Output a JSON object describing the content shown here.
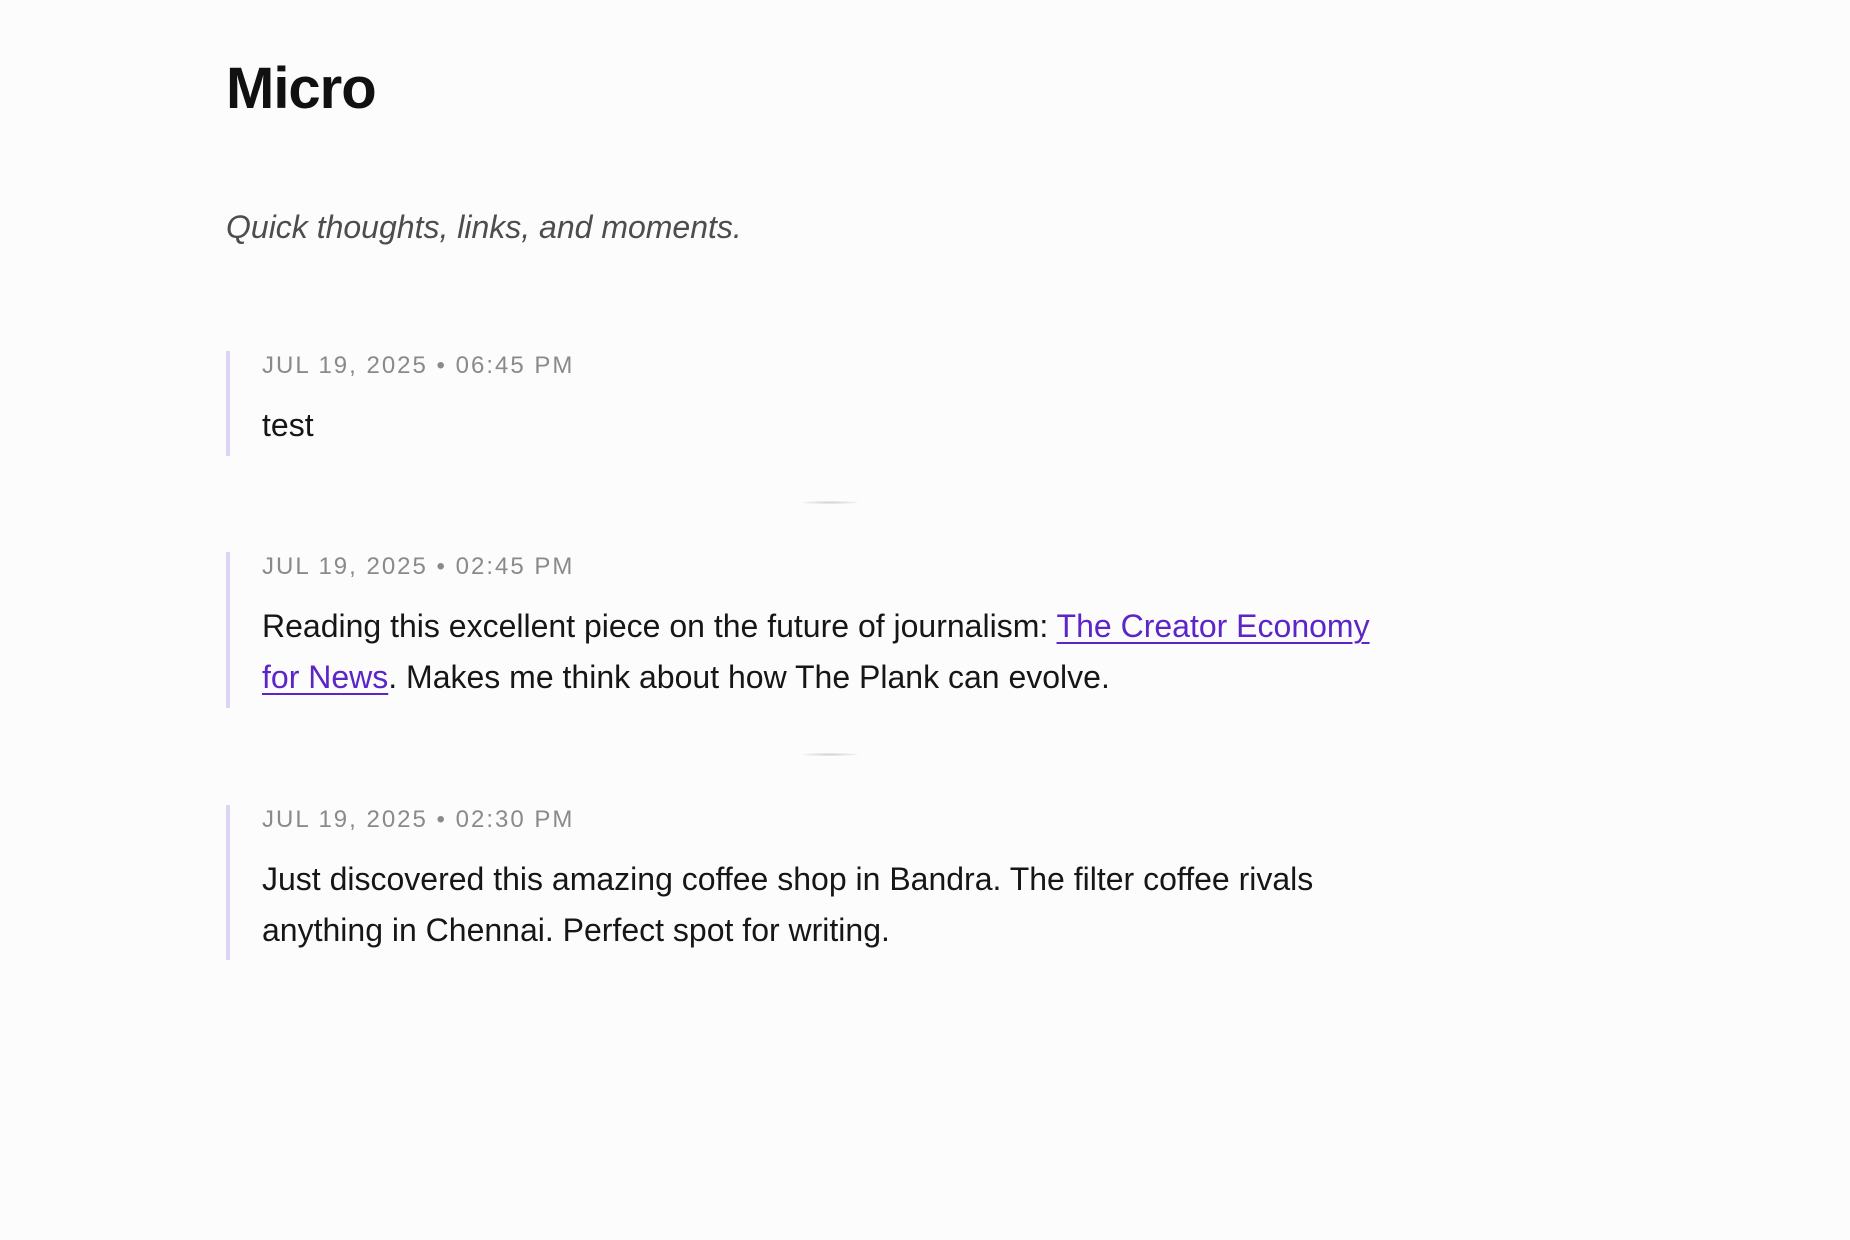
{
  "page": {
    "title": "Micro",
    "subtitle": "Quick thoughts, links, and moments."
  },
  "posts": [
    {
      "meta": "JUL 19, 2025 • 06:45 PM",
      "text": "test"
    },
    {
      "meta": "JUL 19, 2025 • 02:45 PM",
      "text_before": "Reading this excellent piece on the future of journalism: ",
      "link_text": "The Creator Economy for News",
      "text_after": ". Makes me think about how The Plank can evolve."
    },
    {
      "meta": "JUL 19, 2025 • 02:30 PM",
      "text": "Just discovered this amazing coffee shop in Bandra. The filter coffee rivals anything in Chennai. Perfect spot for writing."
    }
  ],
  "colors": {
    "accent_link": "#5b25c8",
    "post_border": "#ddd3f4",
    "background": "#fcfcfc"
  }
}
